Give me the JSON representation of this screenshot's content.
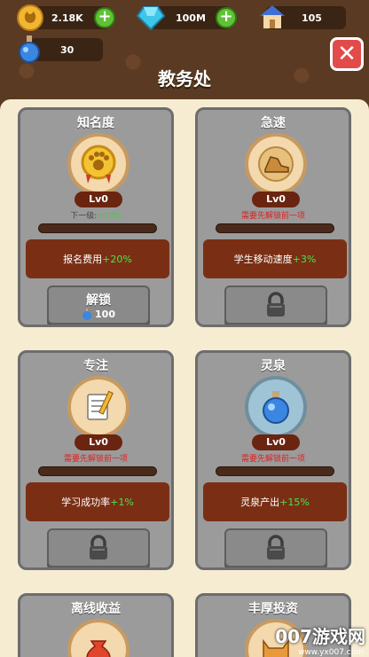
{
  "resources": {
    "coins": "2.18K",
    "gems": "100M",
    "houses": "105",
    "potions": "30"
  },
  "title": "教务处",
  "cards": [
    {
      "name": "知名度",
      "level": "Lv0",
      "requirement_prefix": "下一级:",
      "requirement_value": "+10%",
      "effect_label": "报名费用",
      "effect_value": "+20%",
      "button_label": "解锁",
      "cost": "100"
    },
    {
      "name": "急速",
      "level": "Lv0",
      "requirement": "需要先解锁前一项",
      "effect_label": "学生移动速度",
      "effect_value": "+3%"
    },
    {
      "name": "专注",
      "level": "Lv0",
      "requirement": "需要先解锁前一项",
      "effect_label": "学习成功率",
      "effect_value": "+1%"
    },
    {
      "name": "灵泉",
      "level": "Lv0",
      "requirement": "需要先解锁前一项",
      "effect_label": "灵泉产出",
      "effect_value": "+15%"
    },
    {
      "name": "离线收益"
    },
    {
      "name": "丰厚投资"
    }
  ],
  "watermark": {
    "main": "007游戏网",
    "url": "www.yx007.com"
  },
  "colors": {
    "accent_green": "#5fc234",
    "requirement_red": "#d22222",
    "card_gray": "#9b9b9b",
    "effect_brown": "#7a2f14"
  }
}
